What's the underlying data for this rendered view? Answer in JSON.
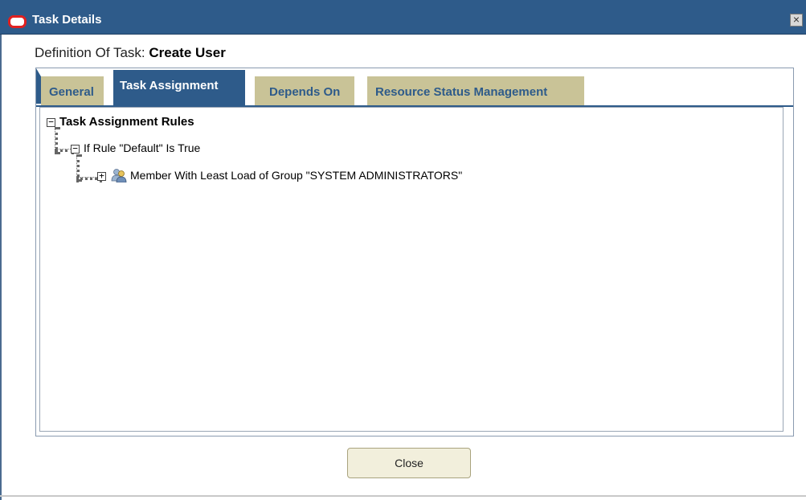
{
  "window": {
    "title": "Task Details",
    "close_label": "×",
    "title_bar_color": "#2e5b8a",
    "logo_icon": "oracle-logo-icon"
  },
  "definition": {
    "label": "Definition Of Task:",
    "task_name": "Create User"
  },
  "tabs": [
    {
      "label": "General",
      "active": false
    },
    {
      "label": "Task Assignment",
      "active": true
    },
    {
      "label": "Depends On",
      "active": false
    },
    {
      "label": "Resource Status Management",
      "active": false
    }
  ],
  "tree": {
    "root": {
      "label": "Task Assignment Rules",
      "toggle": "−",
      "expanded": true
    },
    "rule": {
      "label": "If Rule \"Default\" Is True",
      "toggle": "−",
      "expanded": true
    },
    "member": {
      "label": "Member With Least Load of Group \"SYSTEM ADMINISTRATORS\"",
      "toggle": "+",
      "expanded": false,
      "icon": "user-group-icon"
    }
  },
  "buttons": {
    "close_label": "Close"
  },
  "colors": {
    "tab_active": "#2e5b8a",
    "tab_inactive": "#c9c397",
    "button_bg": "#f2efdc"
  }
}
